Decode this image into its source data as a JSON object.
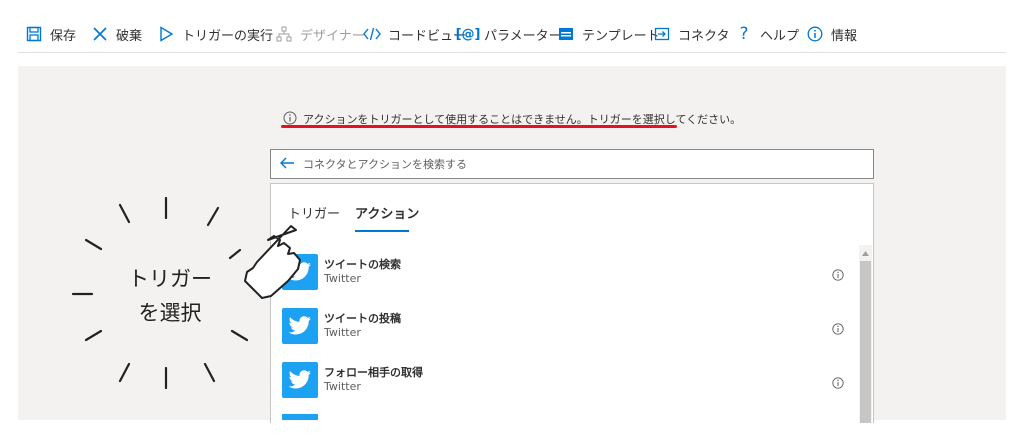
{
  "toolbar": {
    "items": [
      {
        "label": "保存",
        "icon": "save-icon"
      },
      {
        "label": "破棄",
        "icon": "discard-icon"
      },
      {
        "label": "トリガーの実行",
        "icon": "run-icon"
      },
      {
        "label": "デザイナー",
        "icon": "designer-icon"
      },
      {
        "label": "コードビュー",
        "icon": "code-icon"
      },
      {
        "label": "パラメーター",
        "icon": "parameters-icon"
      },
      {
        "label": "テンプレート",
        "icon": "template-icon"
      },
      {
        "label": "コネクタ",
        "icon": "connector-icon"
      },
      {
        "label": "ヘルプ",
        "icon": "help-icon"
      },
      {
        "label": "情報",
        "icon": "info-icon"
      }
    ]
  },
  "warning": {
    "text": "アクションをトリガーとして使用することはできません。トリガーを選択してください。",
    "underline_color": "#e81123"
  },
  "search": {
    "placeholder": "コネクタとアクションを検索する"
  },
  "tabs": [
    {
      "label": "トリガー",
      "active": false
    },
    {
      "label": "アクション",
      "active": true
    }
  ],
  "results": [
    {
      "title": "ツイートの検索",
      "subtitle": "Twitter",
      "icon": "twitter-icon"
    },
    {
      "title": "ツイートの投稿",
      "subtitle": "Twitter",
      "icon": "twitter-icon"
    },
    {
      "title": "フォロー相手の取得",
      "subtitle": "Twitter",
      "icon": "twitter-icon"
    }
  ],
  "annotation": {
    "line1": "トリガー",
    "line2": "を選択",
    "icon": "pointing-hand-icon"
  },
  "colors": {
    "accent": "#0078d4",
    "twitter": "#1da1f2",
    "warning_underline": "#e81123",
    "canvas": "#f3f2f1"
  }
}
